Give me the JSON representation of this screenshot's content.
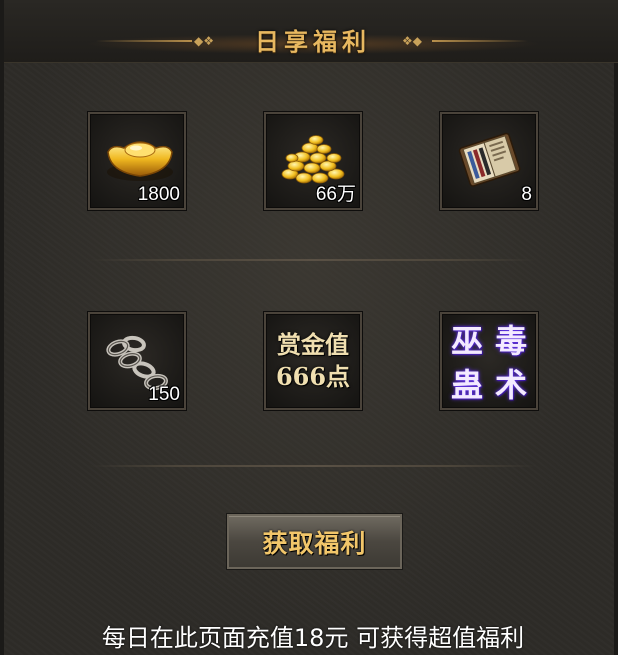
{
  "header": {
    "title": "日享福利"
  },
  "rewards": [
    {
      "icon": "gold-ingot-icon",
      "quantity": "1800"
    },
    {
      "icon": "gold-coins-icon",
      "quantity": "66万"
    },
    {
      "icon": "book-icon",
      "quantity": "8"
    },
    {
      "icon": "iron-chain-icon",
      "quantity": "150"
    },
    {
      "icon": "bounty-value-icon",
      "text_lines": [
        "赏金值",
        "666点"
      ]
    },
    {
      "icon": "poison-art-icon",
      "text_chars": [
        "巫",
        "毒",
        "蛊",
        "术"
      ]
    }
  ],
  "claim_button": {
    "label": "获取福利"
  },
  "footer": {
    "text": "每日在此页面充值18元 可获得超值福利"
  },
  "colors": {
    "title_gold": "#e8b860",
    "button_text": "#f2c66a",
    "poison_glow": "#6a3cf0"
  }
}
